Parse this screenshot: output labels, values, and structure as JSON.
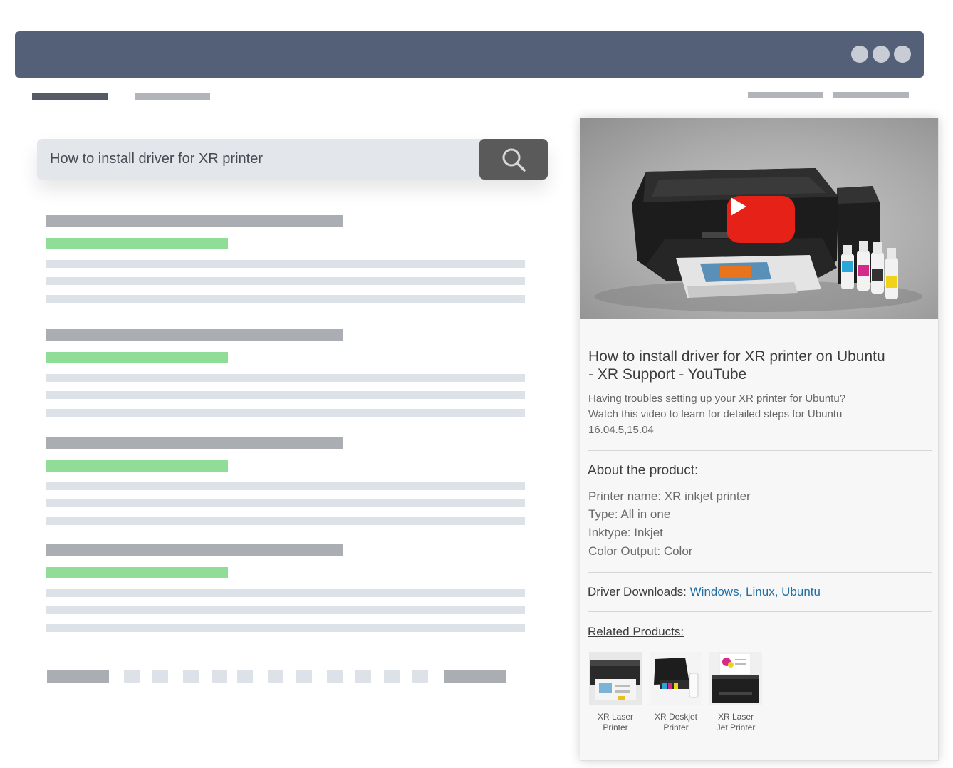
{
  "search": {
    "query": "How to install driver for XR printer",
    "button_icon": "search-icon"
  },
  "card": {
    "video_icon": "youtube-play-icon",
    "title": "How to install driver for XR printer on Ubuntu - XR Support - YouTube",
    "description": "Having troubles setting up your XR printer for Ubuntu? Watch this video to learn for detailed steps for Ubuntu 16.04.5,15.04",
    "about_heading": "About the product:",
    "specs": [
      "Printer name: XR inkjet printer",
      "Type: All in one",
      "Inktype: Inkjet",
      "Color Output: Color"
    ],
    "downloads_label": "Driver Downloads:",
    "downloads": [
      "Windows,",
      "Linux,",
      "Ubuntu"
    ],
    "related_heading": "Related Products:",
    "related": [
      {
        "line1": "XR Laser",
        "line2": "Printer"
      },
      {
        "line1": "XR Deskjet",
        "line2": "Printer"
      },
      {
        "line1": "XR Laser",
        "line2": "Jet Printer"
      }
    ],
    "ink_labels": [
      "C",
      "M",
      "BK",
      "Y"
    ]
  },
  "colors": {
    "titlebar": "#545f78",
    "result_title": "#aaaeb3",
    "result_url": "#90dd98",
    "link": "#1f6fa8",
    "youtube_red": "#e62117"
  }
}
